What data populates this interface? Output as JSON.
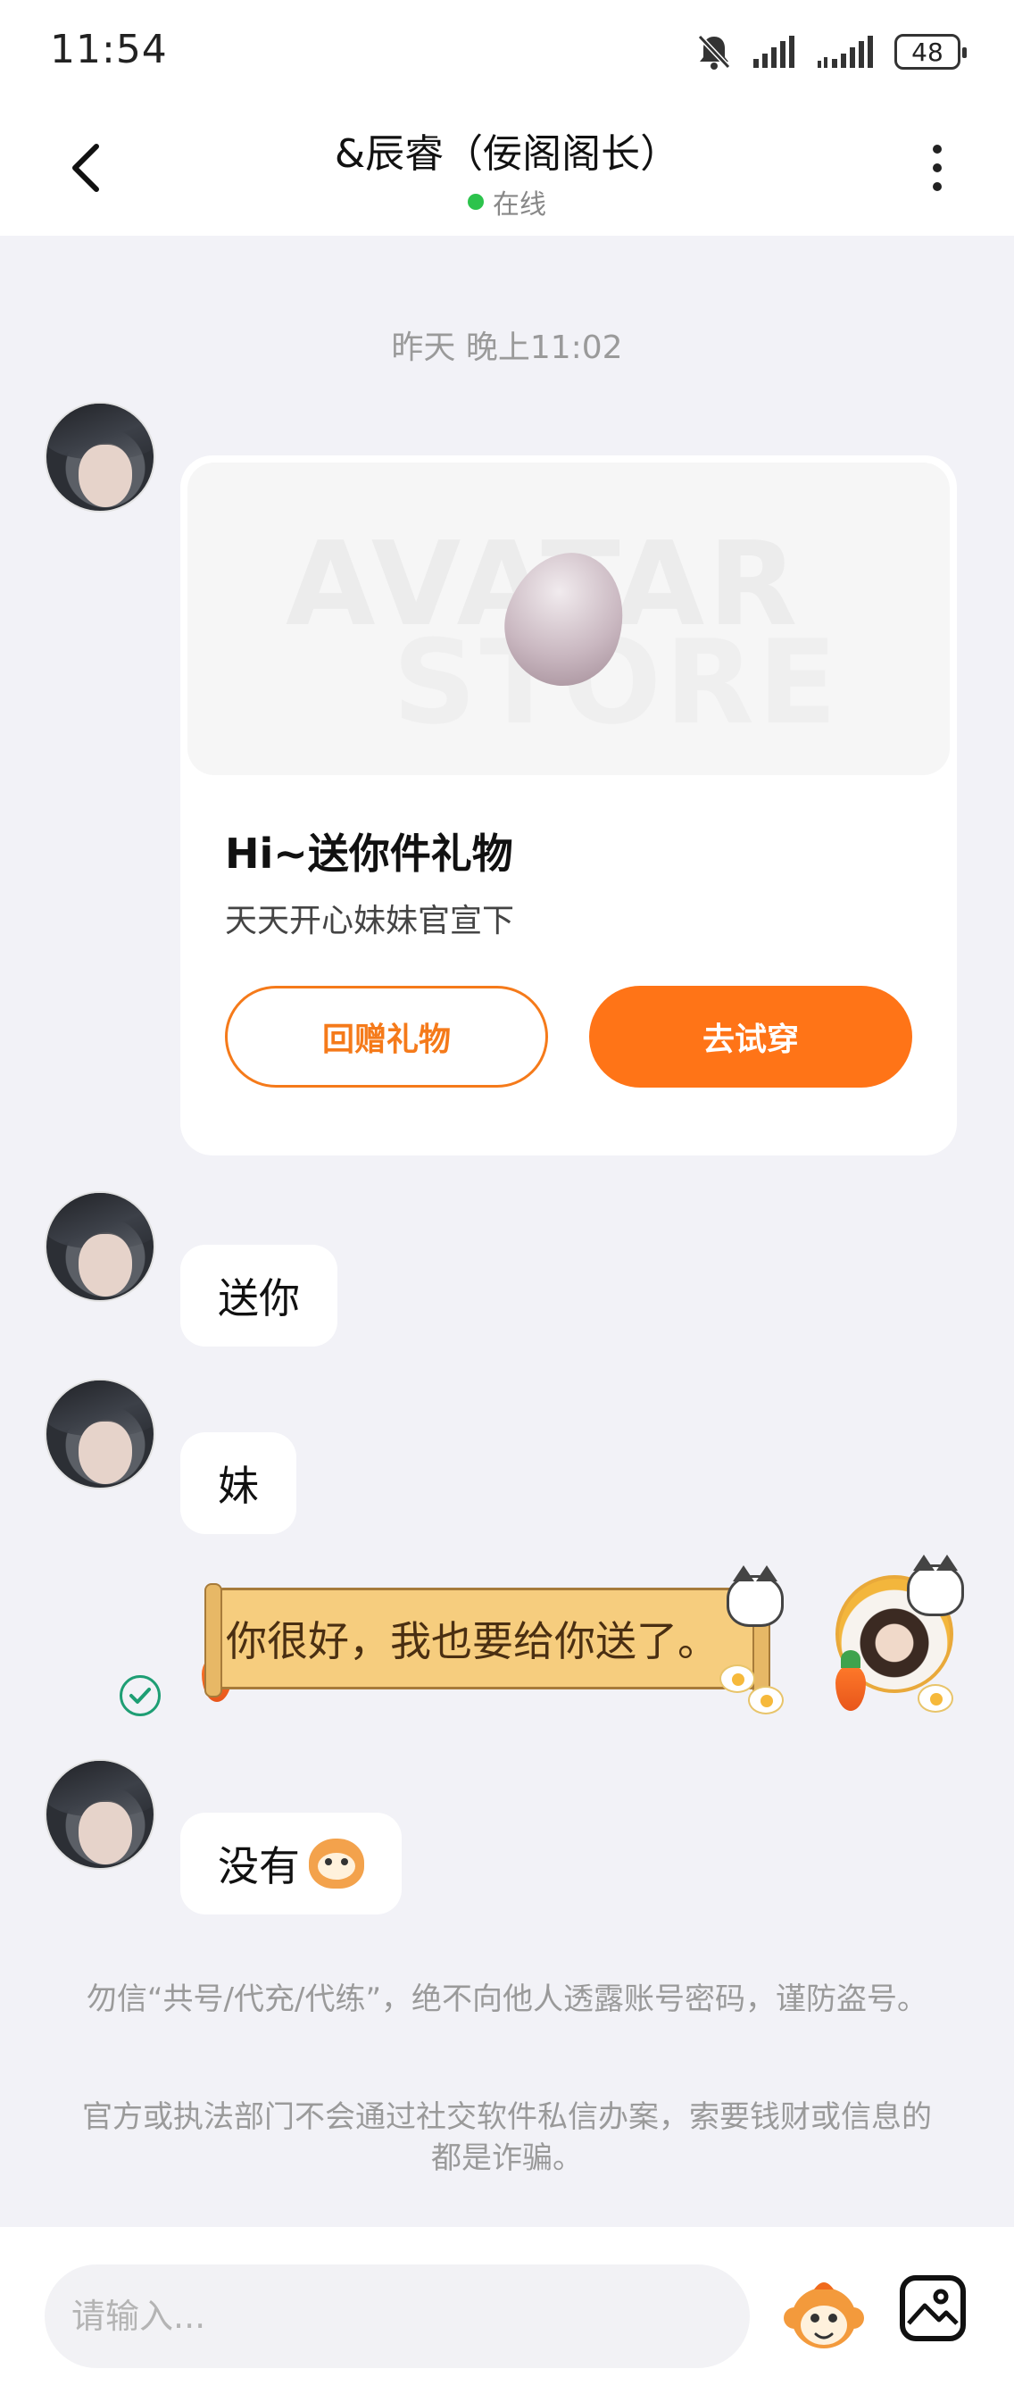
{
  "status_bar": {
    "time": "11:54",
    "battery": "48",
    "icons": [
      "bell-off-icon",
      "signal-icon",
      "signal-icon",
      "battery-icon"
    ]
  },
  "header": {
    "title": "&辰睿（佞阁阁长）",
    "presence": "在线",
    "presence_color": "#2cc34c"
  },
  "chat": {
    "timestamp": "昨天 晚上11:02",
    "gift_card": {
      "banner_watermark": [
        "AVATAR",
        "STORE"
      ],
      "title": "Hi~送你件礼物",
      "subtitle": "天天开心妹妹官宣下",
      "return_gift_label": "回赠礼物",
      "try_on_label": "去试穿",
      "accent": "#ff7417"
    },
    "messages": [
      {
        "from": "other",
        "text": "送你"
      },
      {
        "from": "other",
        "text": "妹"
      },
      {
        "from": "me",
        "text": "你很好，我也要给你送了。",
        "status": "sent"
      },
      {
        "from": "other",
        "text": "没有",
        "emoji": "monkey-face-emoji"
      }
    ],
    "notices": [
      "勿信“共号/代充/代练”，绝不向他人透露账号密码，谨防盗号。",
      "官方或执法部门不会通过社交软件私信办案，索要钱财或信息的都是诈骗。"
    ]
  },
  "input": {
    "placeholder": "请输入..."
  }
}
